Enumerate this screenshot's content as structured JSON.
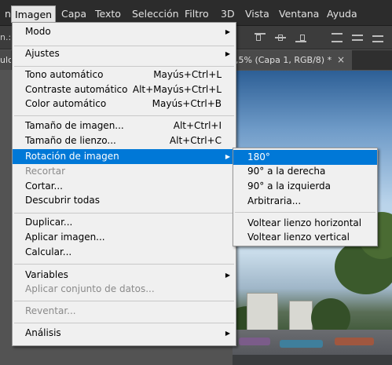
{
  "menubar": {
    "items": [
      {
        "label": "n",
        "active": false
      },
      {
        "label": "Imagen",
        "active": true
      },
      {
        "label": "Capa",
        "active": false
      },
      {
        "label": "Texto",
        "active": false
      },
      {
        "label": "Selección",
        "active": false
      },
      {
        "label": "Filtro",
        "active": false
      },
      {
        "label": "3D",
        "active": false
      },
      {
        "label": "Vista",
        "active": false
      },
      {
        "label": "Ventana",
        "active": false
      },
      {
        "label": "Ayuda",
        "active": false
      }
    ]
  },
  "options_bar": {
    "left_fragment": "n.:"
  },
  "document": {
    "tab_title": ",5% (Capa 1, RGB/8) *",
    "close_glyph": "×",
    "left_fragment": "ulc"
  },
  "image_menu": {
    "items": [
      {
        "label": "Modo",
        "shortcut": "",
        "submenu": true,
        "disabled": false
      },
      {
        "label": "Ajustes",
        "shortcut": "",
        "submenu": true,
        "disabled": false
      },
      {
        "label": "Tono automático",
        "shortcut": "Mayús+Ctrl+L",
        "submenu": false,
        "disabled": false
      },
      {
        "label": "Contraste automático",
        "shortcut": "Alt+Mayús+Ctrl+L",
        "submenu": false,
        "disabled": false
      },
      {
        "label": "Color automático",
        "shortcut": "Mayús+Ctrl+B",
        "submenu": false,
        "disabled": false
      },
      {
        "label": "Tamaño de imagen...",
        "shortcut": "Alt+Ctrl+I",
        "submenu": false,
        "disabled": false
      },
      {
        "label": "Tamaño de lienzo...",
        "shortcut": "Alt+Ctrl+C",
        "submenu": false,
        "disabled": false
      },
      {
        "label": "Rotación de imagen",
        "shortcut": "",
        "submenu": true,
        "disabled": false,
        "highlighted": true
      },
      {
        "label": "Recortar",
        "shortcut": "",
        "submenu": false,
        "disabled": true
      },
      {
        "label": "Cortar...",
        "shortcut": "",
        "submenu": false,
        "disabled": false
      },
      {
        "label": "Descubrir todas",
        "shortcut": "",
        "submenu": false,
        "disabled": false
      },
      {
        "label": "Duplicar...",
        "shortcut": "",
        "submenu": false,
        "disabled": false
      },
      {
        "label": "Aplicar imagen...",
        "shortcut": "",
        "submenu": false,
        "disabled": false
      },
      {
        "label": "Calcular...",
        "shortcut": "",
        "submenu": false,
        "disabled": false
      },
      {
        "label": "Variables",
        "shortcut": "",
        "submenu": true,
        "disabled": false
      },
      {
        "label": "Aplicar conjunto de datos...",
        "shortcut": "",
        "submenu": false,
        "disabled": true
      },
      {
        "label": "Reventar...",
        "shortcut": "",
        "submenu": false,
        "disabled": true
      },
      {
        "label": "Análisis",
        "shortcut": "",
        "submenu": true,
        "disabled": false
      }
    ],
    "submenu_arrow": "▶"
  },
  "rotation_submenu": {
    "items": [
      {
        "label": "180°",
        "highlighted": true
      },
      {
        "label": "90° a la derecha",
        "highlighted": false
      },
      {
        "label": "90° a la izquierda",
        "highlighted": false
      },
      {
        "label": "Arbitraria...",
        "highlighted": false
      },
      {
        "label": "Voltear lienzo horizontal",
        "highlighted": false
      },
      {
        "label": "Voltear lienzo vertical",
        "highlighted": false
      }
    ]
  },
  "colors": {
    "highlight": "#0078d7",
    "menu_bg": "#f0f0f0",
    "menubar_bg": "#2c2c2c",
    "disabled_text": "#8a8a8a"
  }
}
